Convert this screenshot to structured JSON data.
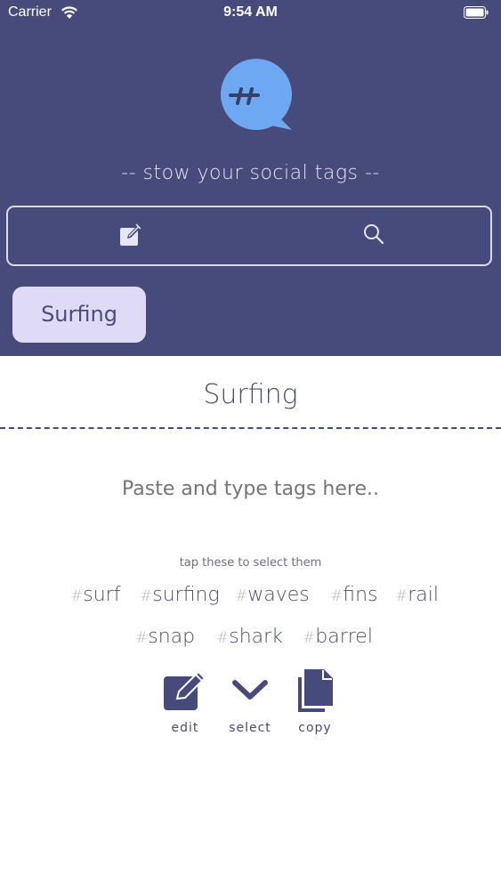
{
  "status": {
    "carrier": "Carrier",
    "time": "9:54 AM"
  },
  "header": {
    "tagline": "-- stow your social tags --"
  },
  "chips": [
    {
      "label": "Surfing"
    }
  ],
  "card": {
    "title": "Surfing",
    "input_placeholder": "Paste and type tags here..",
    "hint": "tap these to select them",
    "tags": [
      {
        "hash": "#",
        "text": "surf"
      },
      {
        "hash": "#",
        "text": "surfing"
      },
      {
        "hash": "#",
        "text": "waves"
      },
      {
        "hash": "#",
        "text": "fins"
      },
      {
        "hash": "#",
        "text": "rail"
      },
      {
        "hash": "#",
        "text": "snap"
      },
      {
        "hash": "#",
        "text": "shark"
      },
      {
        "hash": "#",
        "text": "barrel"
      }
    ],
    "actions": {
      "edit": "edit",
      "select": "select",
      "copy": "copy"
    }
  },
  "colors": {
    "header_bg": "#474b7b",
    "chip_bg": "#dfdbf6",
    "logo_bubble": "#6ea8f2",
    "text_dark": "#4b4d6e"
  },
  "icons": [
    "wifi-icon",
    "battery-icon",
    "hashtag-bubble-logo",
    "edit-icon",
    "search-icon",
    "chevron-down-icon",
    "copy-icon"
  ]
}
